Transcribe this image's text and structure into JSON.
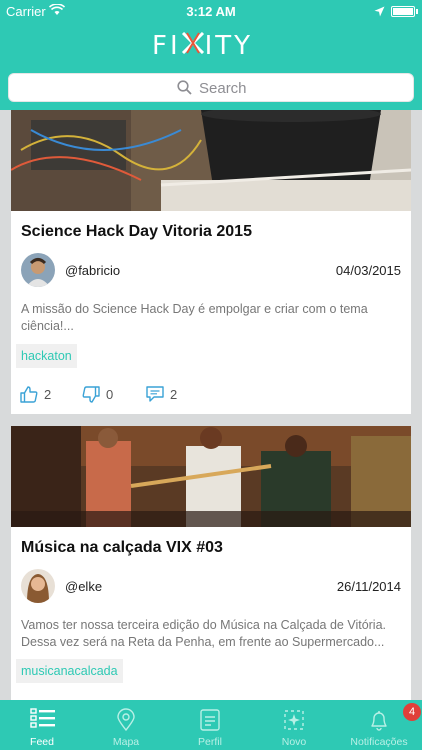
{
  "status_bar": {
    "carrier": "Carrier",
    "time": "3:12 AM"
  },
  "app": {
    "logo_left": "FI",
    "logo_right": "ITY",
    "brand_color": "#2ec9b4"
  },
  "search": {
    "placeholder": "Search"
  },
  "posts": [
    {
      "title": "Science Hack Day Vitoria 2015",
      "username": "@fabricio",
      "date": "04/03/2015",
      "excerpt": "A missão do Science Hack Day é empolgar e criar com o tema ciência!...",
      "tag": "hackaton",
      "likes": "2",
      "dislikes": "0",
      "comments": "2"
    },
    {
      "title": "Música na calçada VIX #03",
      "username": "@elke",
      "date": "26/11/2014",
      "excerpt": "Vamos ter nossa terceira edição do Música na Calçada de Vitória. Dessa vez será na Reta da Penha, em frente ao Supermercado...",
      "tag": "musicanacalcada"
    }
  ],
  "tabbar": {
    "tabs": [
      {
        "label": "Feed",
        "icon": "list-icon",
        "active": true
      },
      {
        "label": "Mapa",
        "icon": "map-pin-icon"
      },
      {
        "label": "Perfil",
        "icon": "profile-card-icon"
      },
      {
        "label": "Novo",
        "icon": "new-sparkle-icon"
      },
      {
        "label": "Notificações",
        "icon": "bell-icon"
      }
    ],
    "notification_badge": "4"
  }
}
